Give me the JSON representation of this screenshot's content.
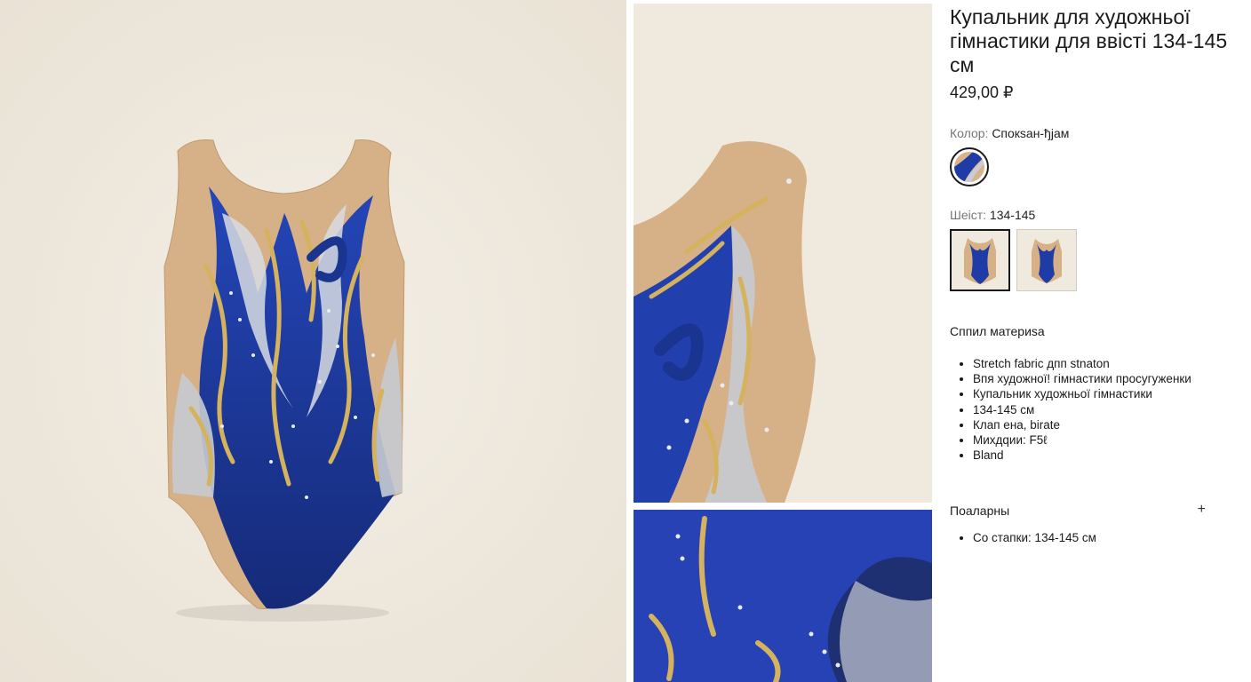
{
  "product": {
    "title": "Купальник для художньої гімнастики для ввісті 134-145 см",
    "price": "429,00 ₽"
  },
  "options": {
    "color": {
      "label": "Колор:",
      "value": "Спокsан-ђјам"
    },
    "size": {
      "label": "Шеіст:",
      "value": "134-145"
    }
  },
  "materials": {
    "heading": "Сппил материsa",
    "items": [
      "Stretch fabric дпп stnaton",
      "Впя художної! гімнастики просугуженки",
      "Купальник художньої гімнастики",
      "134-145 см",
      "Клап ена, birate",
      "Михдqии: F5ℓ",
      "Bland"
    ]
  },
  "care": {
    "heading": "Поаларны",
    "toggle_icon": "+",
    "items": [
      "Со стапки: 134-145 см"
    ]
  },
  "colors": {
    "background": "#efe9de",
    "fabric_blue": "#1f3ca6",
    "nude_mesh": "#d7b48c",
    "gold": "#d4b25e",
    "silver": "#c9cdd3"
  }
}
